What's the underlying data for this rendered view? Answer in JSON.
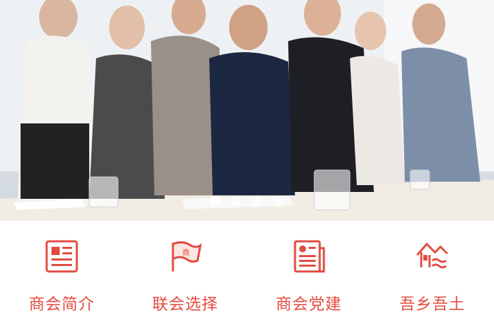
{
  "banner": {
    "image": "group-of-business-people-photo",
    "slide_count": 4,
    "active_slide": 1
  },
  "nav": {
    "accent_color": "#e34b3f",
    "items": [
      {
        "label": "商会简介",
        "icon": "news-document-icon"
      },
      {
        "label": "联会选择",
        "icon": "chamber-flag-icon"
      },
      {
        "label": "商会党建",
        "icon": "party-document-icon"
      },
      {
        "label": "吾乡吾土",
        "icon": "hometown-house-icon"
      }
    ]
  }
}
